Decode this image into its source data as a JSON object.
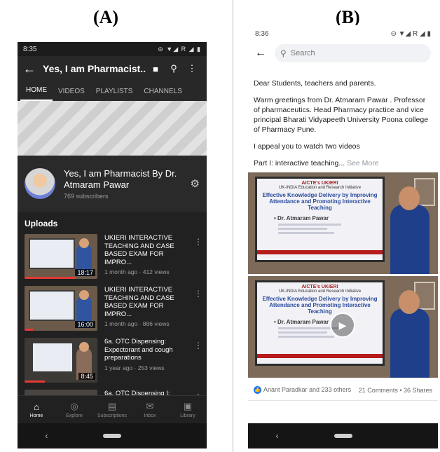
{
  "labels": {
    "a": "(A)",
    "b": "(B)"
  },
  "youtube": {
    "status_time": "8:35",
    "status_icons": "⊝ ▼◢ R ◢ ▮",
    "appbar": {
      "title": "Yes, I am Pharmacist..."
    },
    "tabs": [
      "HOME",
      "VIDEOS",
      "PLAYLISTS",
      "CHANNELS"
    ],
    "channel": {
      "name": "Yes, I am Pharmacist By Dr. Atmaram Pawar",
      "subscribers": "769 subscribers"
    },
    "uploads_heading": "Uploads",
    "videos": [
      {
        "title": "UKIERI INTERACTIVE TEACHING AND CASE BASED EXAM FOR IMPRO...",
        "meta": "1 month ago · 412 views",
        "duration": "18:17"
      },
      {
        "title": "UKIERI INTERACTIVE TEACHING AND CASE BASED EXAM FOR IMPRO...",
        "meta": "1 month ago · 886 views",
        "duration": "16:00"
      },
      {
        "title": "6a. OTC Dispensing: Expectorant and cough preparations",
        "meta": "1 year ago · 253 views",
        "duration": "8:45"
      },
      {
        "title": "6a. OTC Dispensing I:",
        "meta": "",
        "duration": ""
      }
    ],
    "bottom_nav": [
      "Home",
      "Explore",
      "Subscriptions",
      "Inbox",
      "Library"
    ],
    "sys_back": "‹"
  },
  "facebook": {
    "status_time": "8:36",
    "status_icons": "⊝ ▼◢ R ◢ ▮",
    "search_placeholder": "Search",
    "post": {
      "greeting": "Dear Students, teachers and parents.",
      "body": "Warm greetings from Dr. Atmaram Pawar . Professor of pharmaceutics. Head Pharmacy practice and vice principal Bharati Vidyapeeth University Poona college of Pharmacy Pune.",
      "appeal": "I appeal you to watch two videos",
      "part": "Part I: interactive teaching...",
      "see_more": "See More"
    },
    "slides": [
      {
        "header": "AICTE's UKIERI",
        "subheader": "UK-INDIA Education and Research Initiative",
        "title": "Effective Knowledge Delivery by Improving Attendance and Promoting Interactive Teaching",
        "name": "• Dr. Atmaram Pawar"
      },
      {
        "header": "AICTE's UKIERI",
        "subheader": "UK-INDIA Education and Research Initiative",
        "title": "Effective Knowledge Delivery by Improving Attendance and Promoting Interactive Teaching",
        "name": "• Dr. Atmaram Pawar"
      }
    ],
    "reactions": {
      "likes": "Anant Paradkar and 233 others",
      "stats": "21 Comments • 36 Shares"
    },
    "sys_back": "‹"
  }
}
